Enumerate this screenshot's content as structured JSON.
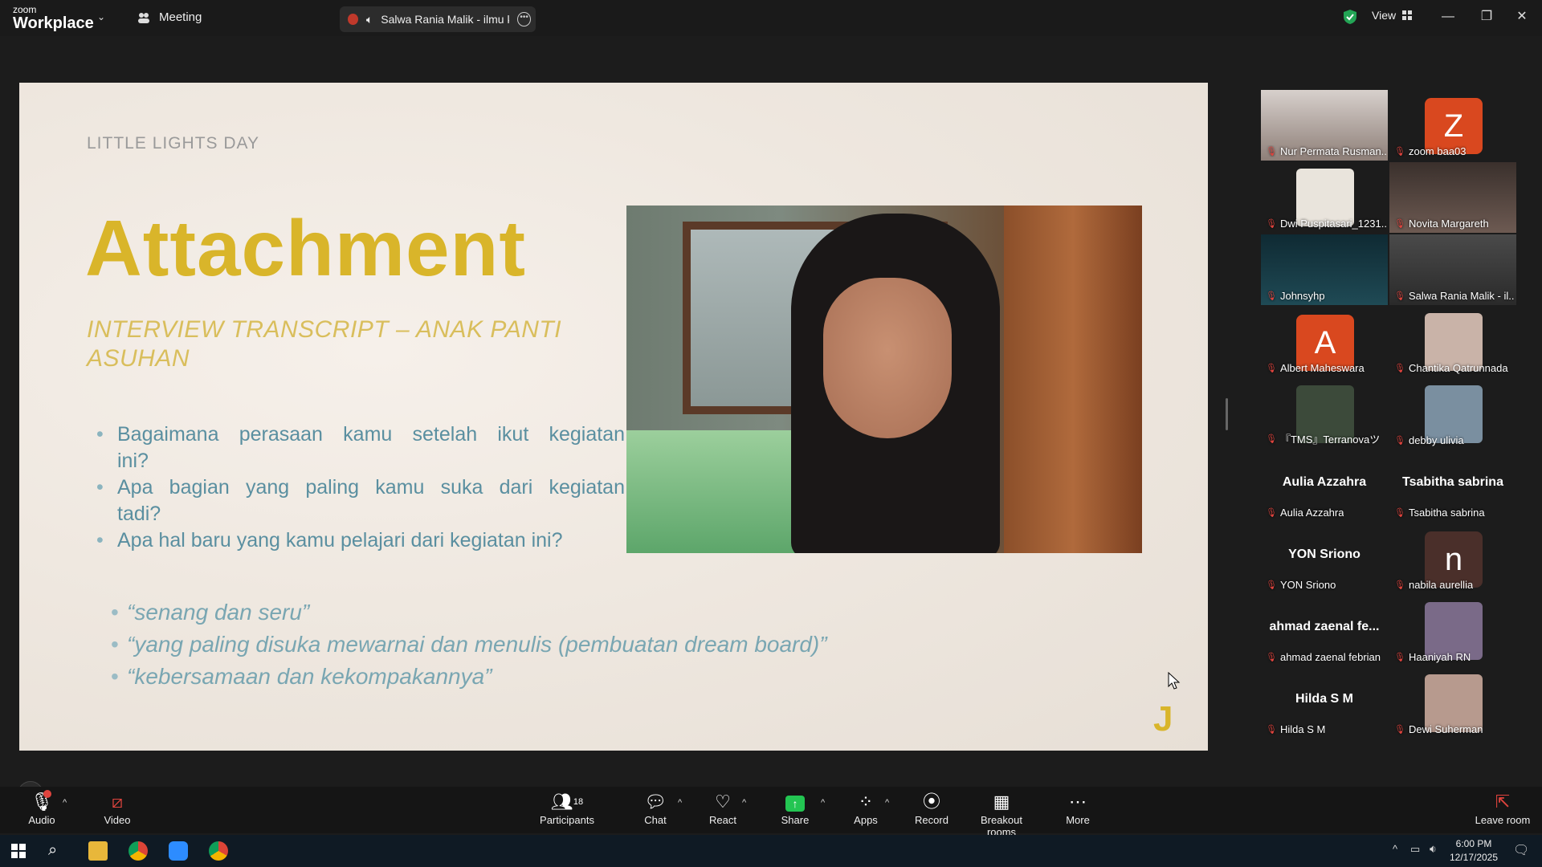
{
  "titlebar": {
    "brand_small": "zoom",
    "brand_big": "Workplace",
    "meeting_label": "Meeting",
    "share_tab_label": "Salwa Rania Malik - ilmu kon",
    "view_label": "View"
  },
  "slide": {
    "kicker": "LITTLE LIGHTS DAY",
    "title": "Attachment",
    "subtitle": "INTERVIEW TRANSCRIPT – ANAK PANTI ASUHAN",
    "questions": [
      "Bagaimana perasaan kamu setelah ikut kegiatan ini?",
      "Apa bagian yang paling kamu suka dari kegiatan tadi?",
      "Apa hal baru yang kamu pelajari dari kegiatan ini?"
    ],
    "answers": [
      "“senang dan seru”",
      "“yang paling disuka mewarnai dan menulis (pembuatan dream board)”",
      "“kebersamaan dan kekompakannya”"
    ],
    "mark": "J"
  },
  "participants": [
    {
      "name": "Nur Permata Rusman...",
      "kind": "video"
    },
    {
      "name": "zoom baa03",
      "kind": "letter",
      "letter": "Z",
      "color": "#d9481f"
    },
    {
      "name": "Dwi Puspitasari_1231...",
      "kind": "thumb"
    },
    {
      "name": "Novita Margareth",
      "kind": "video"
    },
    {
      "name": "Johnsyhp",
      "kind": "video",
      "active": true
    },
    {
      "name": "Salwa Rania Malik - il...",
      "kind": "video"
    },
    {
      "name": "Albert Maheswara",
      "kind": "letter",
      "letter": "A",
      "color": "#d9481f"
    },
    {
      "name": "Chantika Qatrunnada",
      "kind": "thumb"
    },
    {
      "name": "『TMS』Terranovaツ",
      "kind": "thumb"
    },
    {
      "name": "debby ulivia",
      "kind": "thumb"
    },
    {
      "name": "Aulia Azzahra",
      "kind": "text",
      "big": "Aulia Azzahra"
    },
    {
      "name": "Tsabitha sabrina",
      "kind": "text",
      "big": "Tsabitha sabrina"
    },
    {
      "name": "YON Sriono",
      "kind": "text",
      "big": "YON Sriono"
    },
    {
      "name": "nabila aurellia",
      "kind": "letter",
      "letter": "n",
      "color": "#4a2f2a"
    },
    {
      "name": "ahmad zaenal febrian",
      "kind": "text",
      "big": "ahmad zaenal fe..."
    },
    {
      "name": "Haaniyah RN",
      "kind": "thumb"
    },
    {
      "name": "Hilda S M",
      "kind": "text",
      "big": "Hilda S M"
    },
    {
      "name": "Dewi Suherman",
      "kind": "thumb"
    }
  ],
  "toolbar": {
    "audio": "Audio",
    "video": "Video",
    "participants": "Participants",
    "participants_count": "18",
    "chat": "Chat",
    "react": "React",
    "share": "Share",
    "apps": "Apps",
    "record": "Record",
    "breakout": "Breakout rooms",
    "more": "More",
    "leave": "Leave room"
  },
  "taskbar": {
    "time": "6:00 PM",
    "date": "12/17/2025"
  },
  "colors": {
    "accent_gold": "#d9b52a",
    "muted_red": "#e0443e",
    "active_green": "#23d160"
  }
}
